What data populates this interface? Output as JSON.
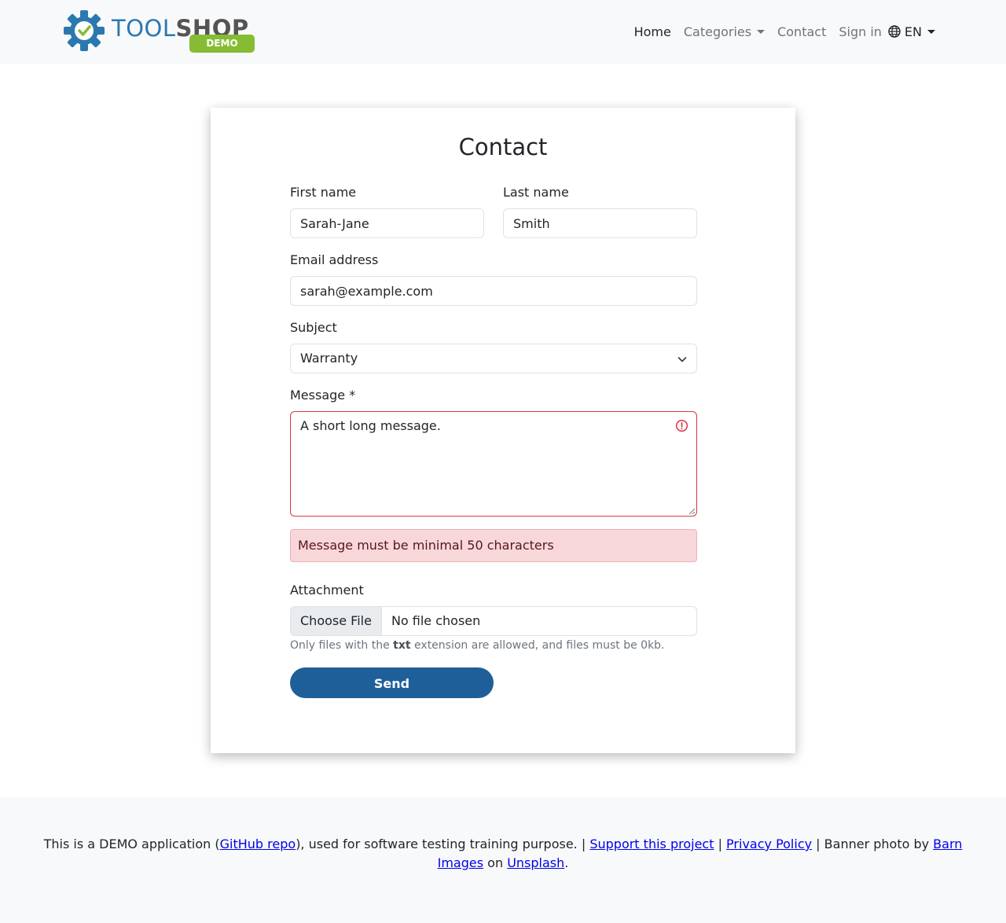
{
  "brand": {
    "name_part1": "TOOL",
    "name_part2": "SHOP",
    "badge": "DEMO",
    "icon": "gear-check-icon",
    "colors": {
      "tool": "#2b78b0",
      "shop": "#545454",
      "badge": "#86bc33",
      "check": "#86bc33"
    }
  },
  "nav": {
    "home": "Home",
    "categories": "Categories",
    "contact": "Contact",
    "sign_in": "Sign in",
    "language": "EN",
    "language_icon": "globe-icon"
  },
  "form": {
    "title": "Contact",
    "first_name": {
      "label": "First name",
      "value": "Sarah-Jane"
    },
    "last_name": {
      "label": "Last name",
      "value": "Smith"
    },
    "email": {
      "label": "Email address",
      "value": "sarah@example.com"
    },
    "subject": {
      "label": "Subject",
      "value": "Warranty"
    },
    "message": {
      "label": "Message *",
      "value": "A short long message.",
      "error": "Message must be minimal 50 characters",
      "error_color": "#dc3545"
    },
    "attachment": {
      "label": "Attachment",
      "button": "Choose File",
      "status": "No file chosen",
      "help_prefix": "Only files with the ",
      "help_ext": "txt",
      "help_suffix": " extension are allowed, and files must be 0kb."
    },
    "send": "Send",
    "send_color": "#1e5f99"
  },
  "footer": {
    "text1": "This is a DEMO application (",
    "github_link": "GitHub repo",
    "text2": "), used for software testing training purpose. | ",
    "support_link": "Support this project",
    "sep1": " | ",
    "privacy_link": "Privacy Policy",
    "text3": " | Banner photo by ",
    "barn_link": "Barn Images",
    "text4": " on ",
    "unsplash_link": "Unsplash",
    "text5": "."
  }
}
